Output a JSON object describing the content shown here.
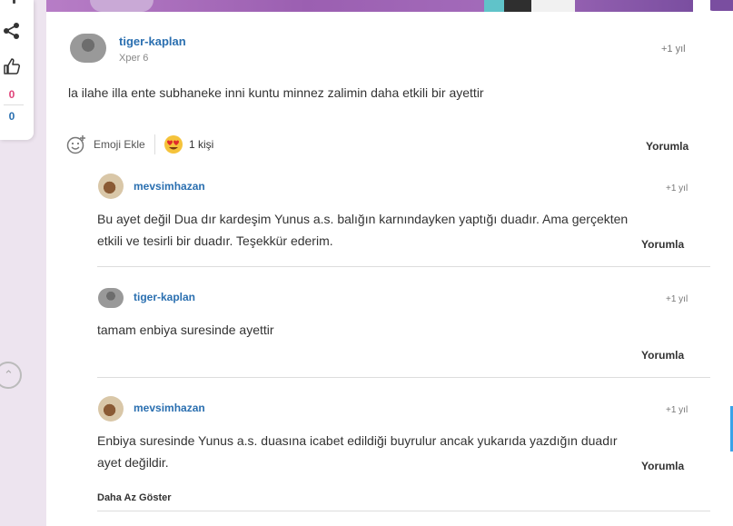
{
  "rail": {
    "like_count": "0",
    "dislike_count": "0"
  },
  "post": {
    "author": "tiger-kaplan",
    "author_subtitle": "Xper 6",
    "time": "+1 yıl",
    "body": "la ilahe illa ente subhaneke inni kuntu minnez zalimin daha etkili bir ayettir",
    "emoji_add_label": "Emoji Ekle",
    "reaction_count": "1 kişi",
    "reply_label": "Yorumla"
  },
  "replies": [
    {
      "author": "mevsimhazan",
      "time": "+1 yıl",
      "lines": [
        "Bu ayet değil Dua dır kardeşim Yunus a.s. balığın karnındayken yaptığı duadır. Ama gerçekten",
        "etkili ve tesirli bir duadır. Teşekkür ederim."
      ],
      "reply_label": "Yorumla"
    },
    {
      "author": "tiger-kaplan",
      "time": "+1 yıl",
      "lines": [
        "tamam enbiya suresinde ayettir"
      ],
      "reply_label": "Yorumla"
    },
    {
      "author": "mevsimhazan",
      "time": "+1 yıl",
      "lines": [
        "Enbiya suresinde Yunus a.s. duasına icabet edildiği buyrulur ancak yukarıda yazdığın duadır",
        "ayet değildir."
      ],
      "reply_label": "Yorumla"
    }
  ],
  "show_less_label": "Daha Az Göster",
  "colors": {
    "link_blue": "#2a6fb0",
    "pink": "#e0447a",
    "page_bg": "#ede4ef"
  }
}
